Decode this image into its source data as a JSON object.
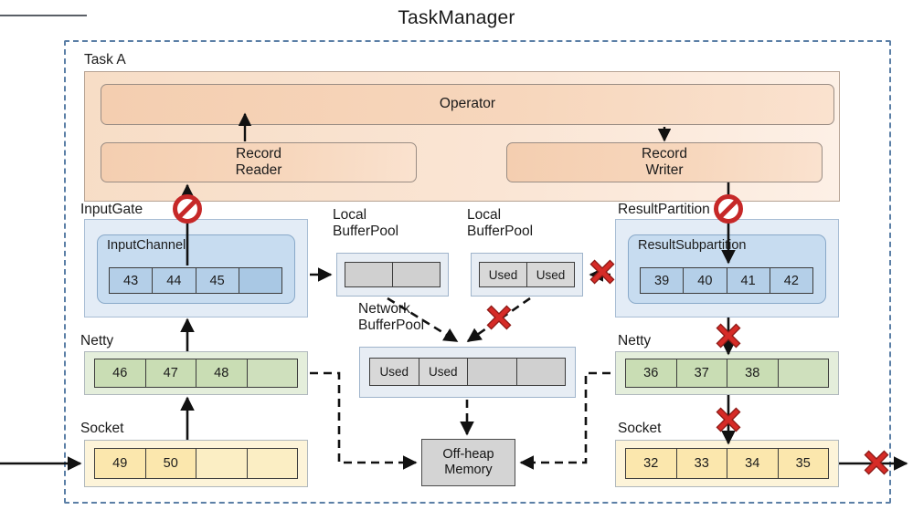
{
  "title": "TaskManager",
  "task": {
    "label": "Task A",
    "operator": "Operator",
    "record_reader": "Record\nReader",
    "record_writer": "Record\nWriter"
  },
  "left": {
    "input_gate_label": "InputGate",
    "input_channel_label": "InputChannel",
    "input_channel_cells": [
      "43",
      "44",
      "45",
      ""
    ],
    "netty_label": "Netty",
    "netty_cells": [
      "46",
      "47",
      "48",
      ""
    ],
    "socket_label": "Socket",
    "socket_cells": [
      "49",
      "50",
      "",
      ""
    ]
  },
  "right": {
    "result_partition_label": "ResultPartition",
    "result_subpartition_label": "ResultSubpartition",
    "result_subpartition_cells": [
      "39",
      "40",
      "41",
      "42"
    ],
    "netty_label": "Netty",
    "netty_cells": [
      "36",
      "37",
      "38",
      ""
    ],
    "socket_label": "Socket",
    "socket_cells": [
      "32",
      "33",
      "34",
      "35"
    ]
  },
  "pools": {
    "local_pool_1_label": "Local\nBufferPool",
    "local_pool_1_cells": [
      "",
      ""
    ],
    "local_pool_2_label": "Local\nBufferPool",
    "local_pool_2_cells": [
      "Used",
      "Used"
    ],
    "network_pool_label": "Network\nBufferPool",
    "network_pool_cells": [
      "Used",
      "Used",
      "",
      ""
    ]
  },
  "memory": {
    "label": "Off-heap\nMemory"
  },
  "markers": {
    "no_entry": "no-entry-sign",
    "blocked": "red-x-blocked"
  },
  "colors": {
    "boundary": "#5b7fa6",
    "task_panel": "#f7ddc6",
    "operator": "#f4ceb0",
    "gate_panel": "#e3ecf6",
    "channel": "#c7dcf0",
    "cell_blue": "#b4cfe8",
    "cell_green": "#c9ddb4",
    "cell_yellow": "#fbe7ad",
    "cell_gray": "#d8d8d8",
    "blocked_red": "#d62b27",
    "offheap": "#d4d4d4"
  }
}
